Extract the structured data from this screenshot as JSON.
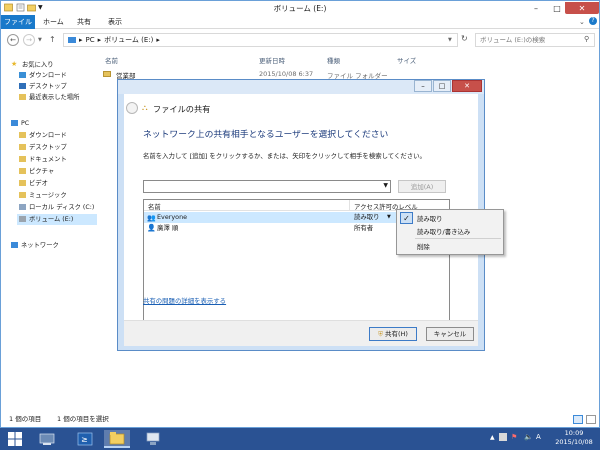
{
  "window": {
    "title": "ボリューム (E:)",
    "minimize": "–",
    "maximize": "□",
    "close": "✕"
  },
  "ribbon": {
    "tabs": [
      "ファイル",
      "ホーム",
      "共有",
      "表示"
    ]
  },
  "address": {
    "path": [
      "PC",
      "ボリューム (E:)"
    ],
    "search_placeholder": "ボリューム (E:)の検索"
  },
  "nav": {
    "favorites_label": "お気に入り",
    "favorites": [
      "ダウンロード",
      "デスクトップ",
      "最近表示した場所"
    ],
    "pc_label": "PC",
    "pc_items": [
      "ダウンロード",
      "デスクトップ",
      "ドキュメント",
      "ピクチャ",
      "ビデオ",
      "ミュージック",
      "ローカル ディスク (C:)",
      "ボリューム (E:)"
    ],
    "network_label": "ネットワーク"
  },
  "columns": {
    "name": "名前",
    "date": "更新日時",
    "type": "種類",
    "size": "サイズ"
  },
  "file": {
    "name": "営業部",
    "date": "2015/10/08 6:37",
    "type": "ファイル フォルダー"
  },
  "status": {
    "count": "1 個の項目",
    "selected": "1 個の項目を選択"
  },
  "dialog": {
    "title": "ファイルの共有",
    "heading": "ネットワーク上の共有相手となるユーザーを選択してください",
    "instruction": "名前を入力して [追加] をクリックするか、または、矢印をクリックして相手を検索してください。",
    "input_value": "",
    "add_button": "追加(A)",
    "list_col_name": "名前",
    "list_col_perm": "アクセス許可のレベル",
    "entries": [
      {
        "name": "Everyone",
        "perm": "読み取り"
      },
      {
        "name": "廣澤 順",
        "perm": "所有者"
      }
    ],
    "share_link": "共有の問題の詳細を表示する",
    "share_button": "共有(H)",
    "cancel_button": "キャンセル",
    "close": "✕",
    "minimize": "–",
    "maximize": "□"
  },
  "perm_menu": {
    "items": [
      "読み取り",
      "読み取り/書き込み",
      "削除"
    ],
    "checked": 0
  },
  "taskbar": {
    "time": "10:09",
    "date": "2015/10/08",
    "lang": "A"
  },
  "colors": {
    "accent": "#1979ca",
    "taskbar": "#2a5293",
    "dialog_frame": "#cde0f5",
    "heading": "#1c3b7c",
    "link": "#1a5fb4",
    "selected_row": "#cce8ff",
    "close": "#c7504a"
  }
}
